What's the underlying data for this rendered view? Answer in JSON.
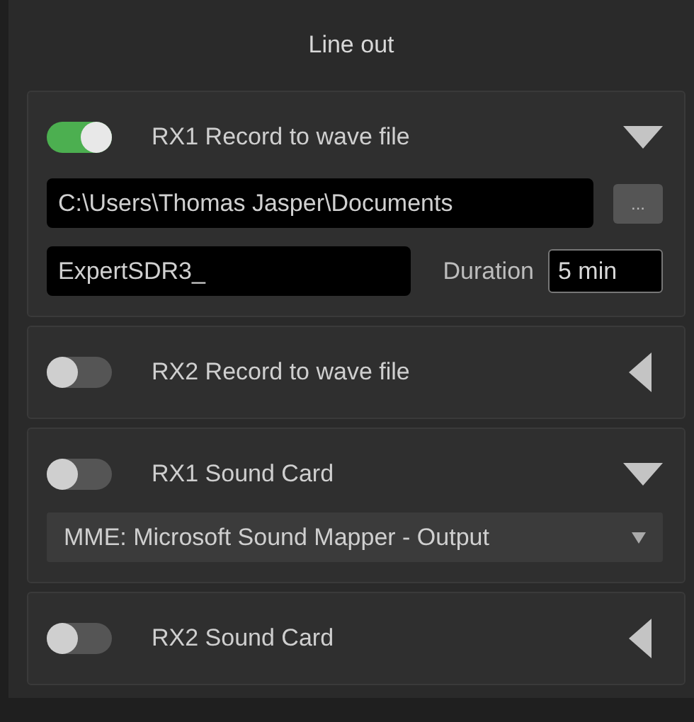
{
  "title": "Line out",
  "sections": [
    {
      "kind": "record",
      "label": "RX1 Record to wave file",
      "on": true,
      "expanded": true,
      "path": "C:\\Users\\Thomas Jasper\\Documents",
      "browse": "...",
      "prefix": "ExpertSDR3_",
      "duration_label": "Duration",
      "duration": "5 min"
    },
    {
      "label": "RX2 Record to wave file",
      "on": false,
      "expanded": false
    },
    {
      "kind": "soundcard",
      "label": "RX1 Sound Card",
      "on": false,
      "expanded": true,
      "device": "MME: Microsoft Sound Mapper - Output"
    },
    {
      "label": "RX2 Sound Card",
      "on": false,
      "expanded": false
    }
  ]
}
